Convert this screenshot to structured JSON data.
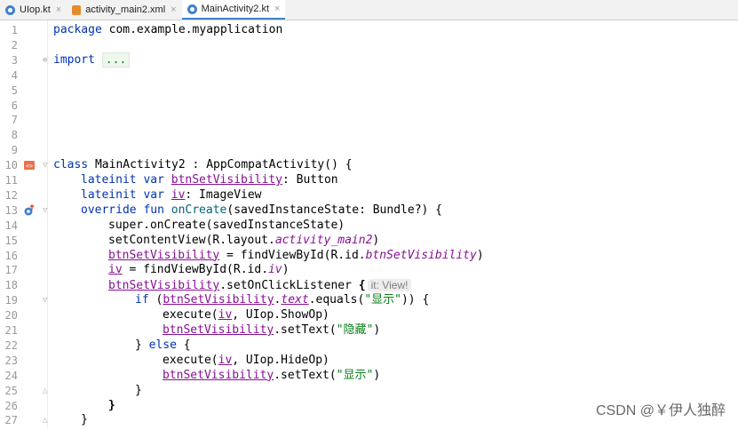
{
  "tabs": [
    {
      "label": "UIop.kt",
      "kind": "kt",
      "active": false
    },
    {
      "label": "activity_main2.xml",
      "kind": "xml",
      "active": false
    },
    {
      "label": "MainActivity2.kt",
      "kind": "kt",
      "active": true
    }
  ],
  "tab_close_glyph": "×",
  "line_numbers": [
    "1",
    "2",
    "3",
    "4",
    "5",
    "6",
    "7",
    "8",
    "9",
    "10",
    "11",
    "12",
    "13",
    "14",
    "15",
    "16",
    "17",
    "18",
    "19",
    "20",
    "21",
    "22",
    "23",
    "24",
    "25",
    "26",
    "27"
  ],
  "code": {
    "l1_kw": "package",
    "l1_pkg": "com.example.myapplication",
    "l3_kw": "import",
    "l3_fold": "...",
    "l10_kw": "class",
    "l10_rest": "MainActivity2 : AppCompatActivity() {",
    "l11_kw": "lateinit var",
    "l11_name": "btnSetVisibility",
    "l11_type": ": Button",
    "l12_kw": "lateinit var",
    "l12_name": "iv",
    "l12_type": ": ImageView",
    "l13_kw": "override fun",
    "l13_fn": "onCreate",
    "l13_rest": "(savedInstanceState: Bundle?) {",
    "l14": "super.onCreate(savedInstanceState)",
    "l15_a": "setContentView(R.layout.",
    "l15_b": "activity_main2",
    "l15_c": ")",
    "l16_a": "btnSetVisibility",
    "l16_b": " = findViewById(R.id.",
    "l16_c": "btnSetVisibility",
    "l16_d": ")",
    "l17_a": "iv",
    "l17_b": " = findViewById(R.id.",
    "l17_c": "iv",
    "l17_d": ")",
    "l18_a": "btnSetVisibility",
    "l18_b": ".setOnClickListener ",
    "l18_brace": "{",
    "l18_hint": "it: View!",
    "l19_kw": "if",
    "l19_a": " (",
    "l19_b": "btnSetVisibility",
    "l19_c": ".",
    "l19_d": "text",
    "l19_e": ".equals(",
    "l19_str": "\"显示\"",
    "l19_f": ")) {",
    "l20_a": "execute(",
    "l20_b": "iv",
    "l20_c": ", UIop.ShowOp)",
    "l21_a": "btnSetVisibility",
    "l21_b": ".setText(",
    "l21_str": "\"隐藏\"",
    "l21_c": ")",
    "l22_a": "} ",
    "l22_kw": "else",
    "l22_b": " {",
    "l23_a": "execute(",
    "l23_b": "iv",
    "l23_c": ", UIop.HideOp)",
    "l24_a": "btnSetVisibility",
    "l24_b": ".setText(",
    "l24_str": "\"显示\"",
    "l24_c": ")",
    "l25": "}",
    "l26": "}",
    "l27": "}"
  },
  "watermark": "CSDN @￥伊人独醉",
  "colors": {
    "keyword": "#0033b3",
    "reference": "#871094",
    "string": "#067d17",
    "active_tab": "#4083c9"
  }
}
